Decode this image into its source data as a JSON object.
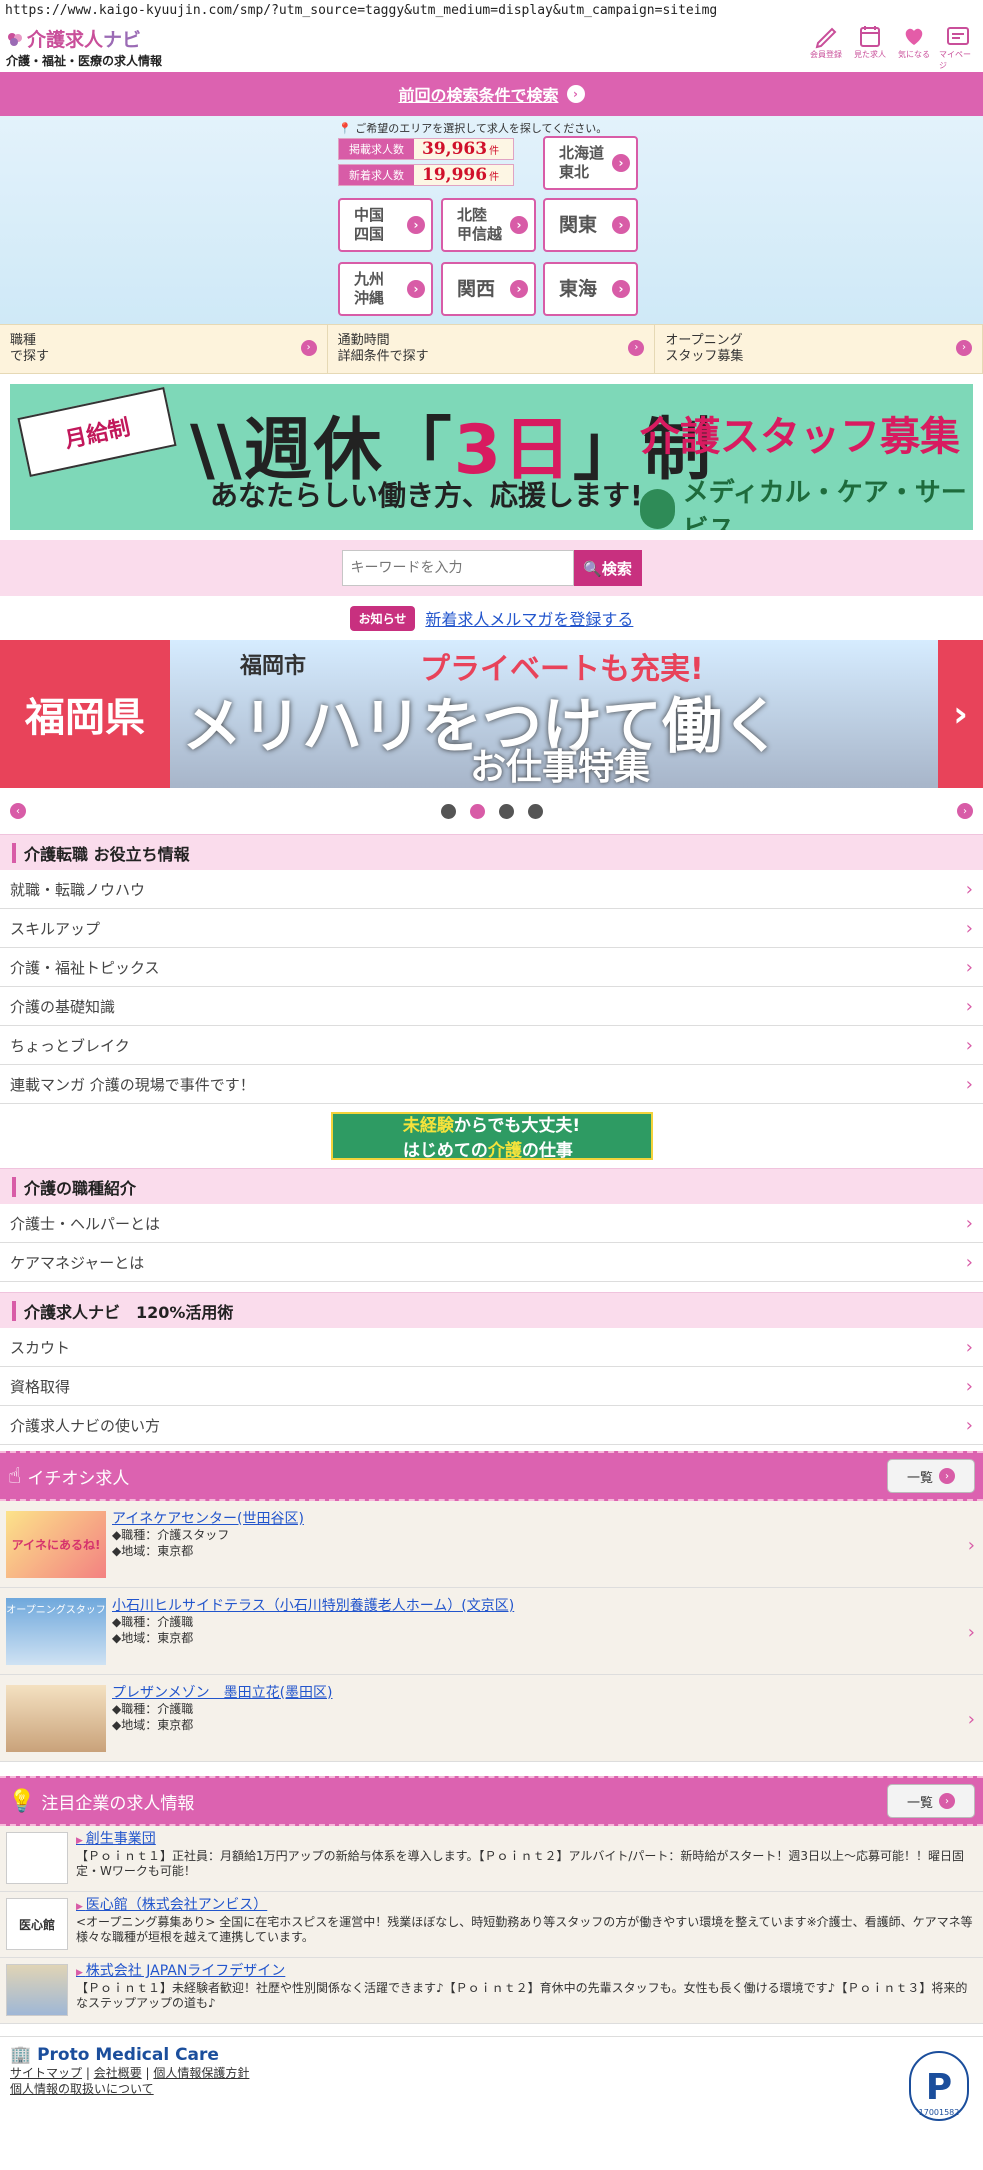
{
  "url": "https://www.kaigo-kyuujin.com/smp/?utm_source=taggy&utm_medium=display&utm_campaign=siteimg",
  "header": {
    "logo_a": "介護求人",
    "logo_b": "ナビ",
    "logo_sub": "介護・福祉・医療の求人情報",
    "icons": [
      {
        "name": "pencil-icon",
        "label": "会員登録"
      },
      {
        "name": "calendar-icon",
        "label": "見た求人"
      },
      {
        "name": "heart-icon",
        "label": "気になる"
      },
      {
        "name": "mypage-icon",
        "label": "マイページ"
      }
    ]
  },
  "prev_search": "前回の検索条件で検索",
  "area": {
    "note": "ご希望のエリアを選択して求人を探してください。",
    "posted_label": "掲載求人数",
    "posted_value": "39,963",
    "new_label": "新着求人数",
    "new_value": "19,996",
    "unit": "件",
    "regions": [
      "北海道\n東北",
      "中国\n四国",
      "北陸\n甲信越",
      "関東",
      "九州\n沖縄",
      "関西",
      "東海"
    ]
  },
  "tri": [
    "職種\nで探す",
    "通勤時間\n詳細条件で探す",
    "オープニング\nスタッフ募集"
  ],
  "banner1": {
    "flag": "月給制",
    "main_a": "\\\\週休「",
    "main_b": "3日",
    "main_c": "」制",
    "sub": "あなたらしい働き方、応援します!",
    "right": "介護スタッフ募集",
    "company": "メディカル・ケア・サービス"
  },
  "search": {
    "placeholder": "キーワードを入力",
    "button": "検索"
  },
  "notice": {
    "badge": "お知らせ",
    "link": "新着求人メルマガを登録する"
  },
  "banner2": {
    "left": "福岡県",
    "city": "福岡市",
    "private": "プライベートも充実!",
    "main": "メリハリをつけて働く",
    "feature": "お仕事特集",
    "arrow": "›"
  },
  "tips": {
    "title": "介護転職 お役立ち情報",
    "items": [
      "就職・転職ノウハウ",
      "スキルアップ",
      "介護・福祉トピックス",
      "介護の基礎知識",
      "ちょっとブレイク",
      "連載マンガ 介護の現場で事件です！"
    ]
  },
  "mini_banner": {
    "a": "未経験",
    "b": "からでも大丈夫!",
    "c": "はじめての",
    "d": "介護",
    "e": "の仕事"
  },
  "jobs_intro": {
    "title": "介護の職種紹介",
    "items": [
      "介護士・ヘルパーとは",
      "ケアマネジャーとは"
    ]
  },
  "howto": {
    "title": "介護求人ナビ　120%活用術",
    "items": [
      "スカウト",
      "資格取得",
      "介護求人ナビの使い方"
    ]
  },
  "pickup": {
    "title": "イチオシ求人",
    "list_btn": "一覧",
    "items": [
      {
        "name": "アイネケアセンター(世田谷区)",
        "job": "◆職種：介護スタッフ",
        "area": "◆地域：東京都",
        "thumb": "アイネにあるね!"
      },
      {
        "name": "小石川ヒルサイドテラス（小石川特別養護老人ホーム）(文京区)",
        "job": "◆職種：介護職",
        "area": "◆地域：東京都",
        "thumb": "オープニングスタッフ"
      },
      {
        "name": "プレザンメゾン　墨田立花(墨田区)",
        "job": "◆職種：介護職",
        "area": "◆地域：東京都",
        "thumb": ""
      }
    ]
  },
  "companies": {
    "title": "注目企業の求人情報",
    "list_btn": "一覧",
    "items": [
      {
        "name": "創生事業団",
        "desc": "【Ｐｏｉｎｔ１】正社員：月額給1万円アップの新給与体系を導入します。【Ｐｏｉｎｔ２】アルバイト/パート：新時給がスタート！週3日以上～応募可能！！曜日固定・Wワークも可能！",
        "thumb": ""
      },
      {
        "name": "医心館（株式会社アンビス）",
        "desc": "<オープニング募集あり> 全国に在宅ホスピスを運営中！残業ほぼなし、時短勤務あり等スタッフの方が働きやすい環境を整えています※介護士、看護師、ケアマネ等様々な職種が垣根を越えて連携しています。",
        "thumb": "医心館"
      },
      {
        "name": "株式会社 JAPANライフデザイン",
        "desc": "【Ｐｏｉｎｔ１】未経験者歓迎！社歴や性別関係なく活躍できます♪【Ｐｏｉｎｔ２】育休中の先輩スタッフも。女性も長く働ける環境です♪【Ｐｏｉｎｔ３】将来的なステップアップの道も♪",
        "thumb": ""
      }
    ]
  },
  "footer": {
    "brand": "Proto Medical Care",
    "links": [
      "サイトマップ",
      "会社概要",
      "個人情報保護方針",
      "個人情報の取扱いについて"
    ],
    "privacy_no": "17001582"
  },
  "colors": {
    "accent": "#dc62b0",
    "red": "#e8435a",
    "mint": "#7ed8b8"
  }
}
